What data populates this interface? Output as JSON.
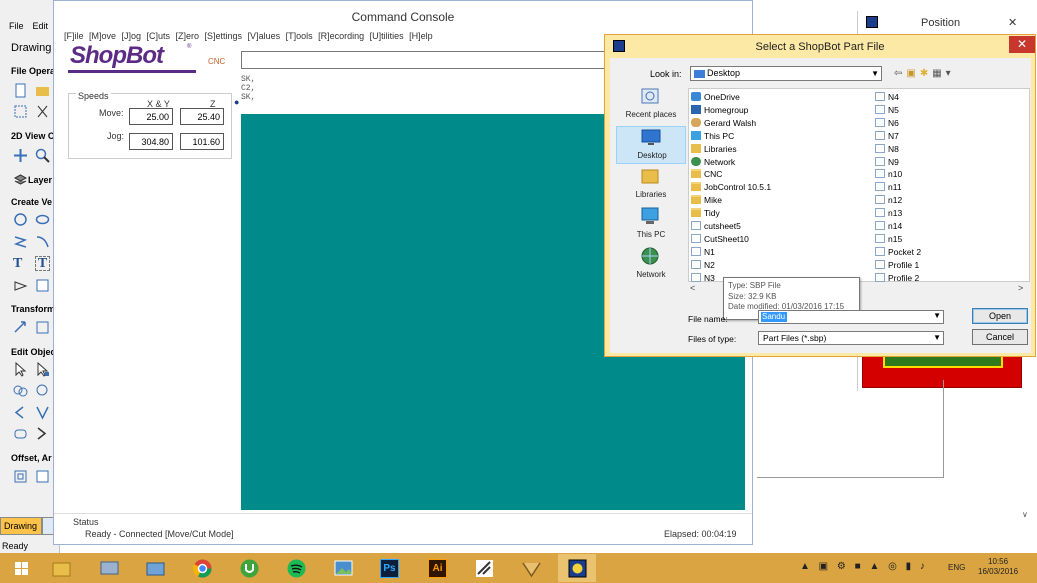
{
  "vectric": {
    "menu": [
      "File",
      "Edit"
    ],
    "drawing_tab": "Drawing",
    "sections": [
      "File Opera",
      "2D View C",
      "Layer",
      "Create Ve",
      "Transform",
      "Edit Objec",
      "Offset, Ar"
    ],
    "status": "Ready"
  },
  "console": {
    "title": "Command Console",
    "menu": "[F]ile  [M]ove  [J]og  [C]uts  [Z]ero  [S]ettings  [V]alues  [T]ools  [R]ecording  [U]tilities  [H]elp",
    "logo_text": "ShopBot",
    "logo_sub": "CNC",
    "log_lines": [
      "SK,",
      "C2,",
      "SK,"
    ],
    "bullet": "●",
    "speeds": {
      "group": "Speeds",
      "col_xy": "X & Y",
      "col_z": "Z",
      "move_label": "Move:",
      "jog_label": "Jog:",
      "move_xy": "25.00",
      "move_z": "25.40",
      "jog_xy": "304.80",
      "jog_z": "101.60"
    },
    "status_label": "Status",
    "status_text": "Ready - Connected  [Move/Cut Mode]",
    "elapsed": "Elapsed: 00:04:19",
    "screen_color": "#008b8b"
  },
  "position_window": {
    "title": "Position",
    "close": "✕"
  },
  "dialog": {
    "title": "Select a ShopBot Part File",
    "close": "✕",
    "look_in_label": "Look in:",
    "look_in_value": "Desktop",
    "places": [
      "Recent places",
      "Desktop",
      "Libraries",
      "This PC",
      "Network"
    ],
    "selected_place": "Desktop",
    "files_col1": [
      {
        "name": "OneDrive",
        "icon": "blue"
      },
      {
        "name": "Homegroup",
        "icon": "home"
      },
      {
        "name": "Gerard Walsh",
        "icon": "user"
      },
      {
        "name": "This PC",
        "icon": "pc"
      },
      {
        "name": "Libraries",
        "icon": "lib"
      },
      {
        "name": "Network",
        "icon": "net"
      },
      {
        "name": "CNC",
        "icon": "folder"
      },
      {
        "name": "JobControl 10.5.1",
        "icon": "folder"
      },
      {
        "name": "Mike",
        "icon": "folder"
      },
      {
        "name": "Tidy",
        "icon": "folder"
      },
      {
        "name": "cutsheet5",
        "icon": "file"
      },
      {
        "name": "CutSheet10",
        "icon": "file"
      },
      {
        "name": "N1",
        "icon": "file"
      },
      {
        "name": "N2",
        "icon": "file"
      },
      {
        "name": "N3",
        "icon": "file"
      }
    ],
    "files_col2": [
      "N4",
      "N5",
      "N6",
      "N7",
      "N8",
      "N9",
      "n10",
      "n11",
      "n12",
      "n13",
      "n14",
      "n15",
      "Pocket 2",
      "Profile 1",
      "Profile 2"
    ],
    "tooltip": [
      "Type: SBP File",
      "Size: 32.9 KB",
      "Date modified: 01/03/2016 17:15"
    ],
    "file_name_label": "File name:",
    "file_name_value": "Sandu",
    "files_of_type_label": "Files of type:",
    "files_of_type_value": "Part Files (*.sbp)",
    "open_label": "Open",
    "cancel_label": "Cancel"
  },
  "taskbar": {
    "apps": [
      "windows-explorer",
      "network-drive",
      "folder",
      "chrome",
      "utorrent",
      "spotify",
      "photos",
      "photoshop",
      "illustrator",
      "shopbot-editor",
      "vcarve",
      "shopbot-console"
    ],
    "ps_label": "Ps",
    "ai_label": "Ai",
    "tray_icons": "▲ ▣ ⚙ ■ ▲ ◎ ▮ ♪",
    "lang": "ENG",
    "time": "10:56",
    "date": "16/03/2016"
  },
  "colors": {
    "taskbar": "#d9a441",
    "dialog": "#fce9a6",
    "teal": "#008b8b",
    "logo": "#5b2b86"
  }
}
